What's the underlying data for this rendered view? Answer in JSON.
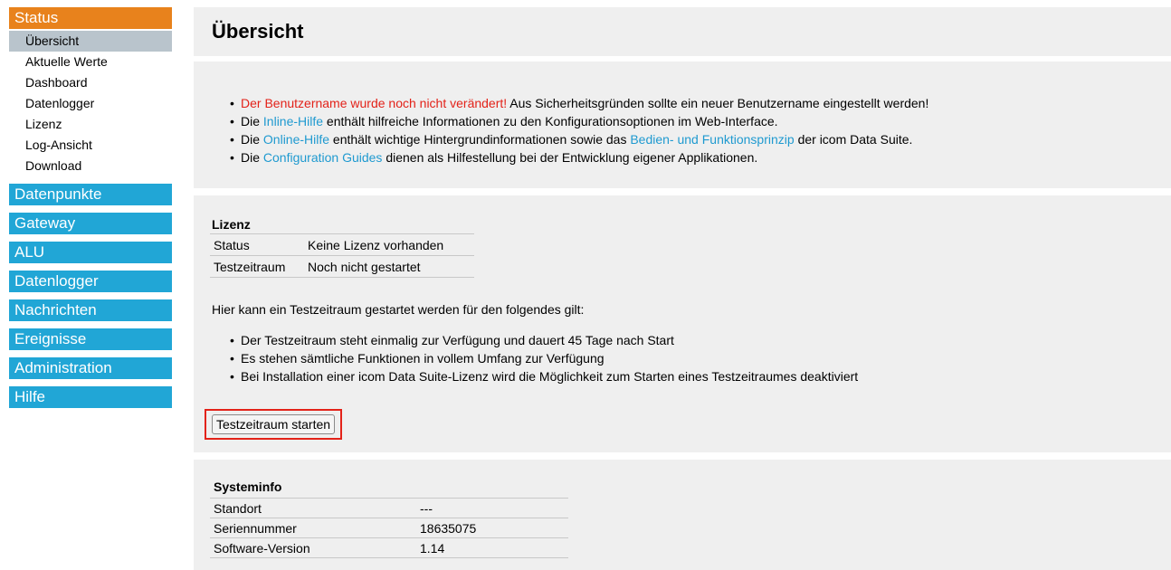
{
  "sidebar": {
    "status_label": "Status",
    "status_items": [
      {
        "label": "Übersicht"
      },
      {
        "label": "Aktuelle Werte"
      },
      {
        "label": "Dashboard"
      },
      {
        "label": "Datenlogger"
      },
      {
        "label": "Lizenz"
      },
      {
        "label": "Log-Ansicht"
      },
      {
        "label": "Download"
      }
    ],
    "sections": [
      {
        "label": "Datenpunkte"
      },
      {
        "label": "Gateway"
      },
      {
        "label": "ALU"
      },
      {
        "label": "Datenlogger"
      },
      {
        "label": "Nachrichten"
      },
      {
        "label": "Ereignisse"
      },
      {
        "label": "Administration"
      },
      {
        "label": "Hilfe"
      }
    ]
  },
  "main": {
    "title": "Übersicht",
    "info": {
      "line1": {
        "warning": "Der Benutzername wurde noch nicht verändert!",
        "rest": " Aus Sicherheitsgründen sollte ein neuer Benutzername eingestellt werden!"
      },
      "line2": {
        "pre": "Die ",
        "link": "Inline-Hilfe",
        "post": " enthält hilfreiche Informationen zu den Konfigurationsoptionen im Web-Interface."
      },
      "line3": {
        "pre": "Die ",
        "link": "Online-Hilfe",
        "mid": " enthält wichtige Hintergrundinformationen sowie das ",
        "link2": "Bedien- und Funktionsprinzip",
        "post": " der icom Data Suite."
      },
      "line4": {
        "pre": "Die ",
        "link": "Configuration Guides",
        "post": " dienen als Hilfestellung bei der Entwicklung eigener Applikationen."
      }
    },
    "license": {
      "title": "Lizenz",
      "rows": [
        {
          "key": "Status",
          "value": "Keine Lizenz vorhanden"
        },
        {
          "key": "Testzeitraum",
          "value": "Noch nicht gestartet"
        }
      ],
      "intro": "Hier kann ein Testzeitraum gestartet werden für den folgendes gilt:",
      "bullets": [
        "Der Testzeitraum steht einmalig zur Verfügung und dauert 45 Tage nach Start",
        "Es stehen sämtliche Funktionen in vollem Umfang zur Verfügung",
        "Bei Installation einer icom Data Suite-Lizenz wird die Möglichkeit zum Starten eines Testzeitraumes deaktiviert"
      ],
      "button_label": "Testzeitraum starten"
    },
    "sysinfo": {
      "title": "Systeminfo",
      "rows": [
        {
          "key": "Standort",
          "value": "---"
        },
        {
          "key": "Seriennummer",
          "value": "18635075"
        },
        {
          "key": "Software-Version",
          "value": "1.14"
        }
      ]
    }
  },
  "colors": {
    "status_orange": "#e8821c",
    "nav_blue": "#21a6d6",
    "active_item": "#b9c4cc",
    "panel_gray": "#efefef",
    "warning_red": "#e32219",
    "link_blue": "#1f9ad0"
  }
}
